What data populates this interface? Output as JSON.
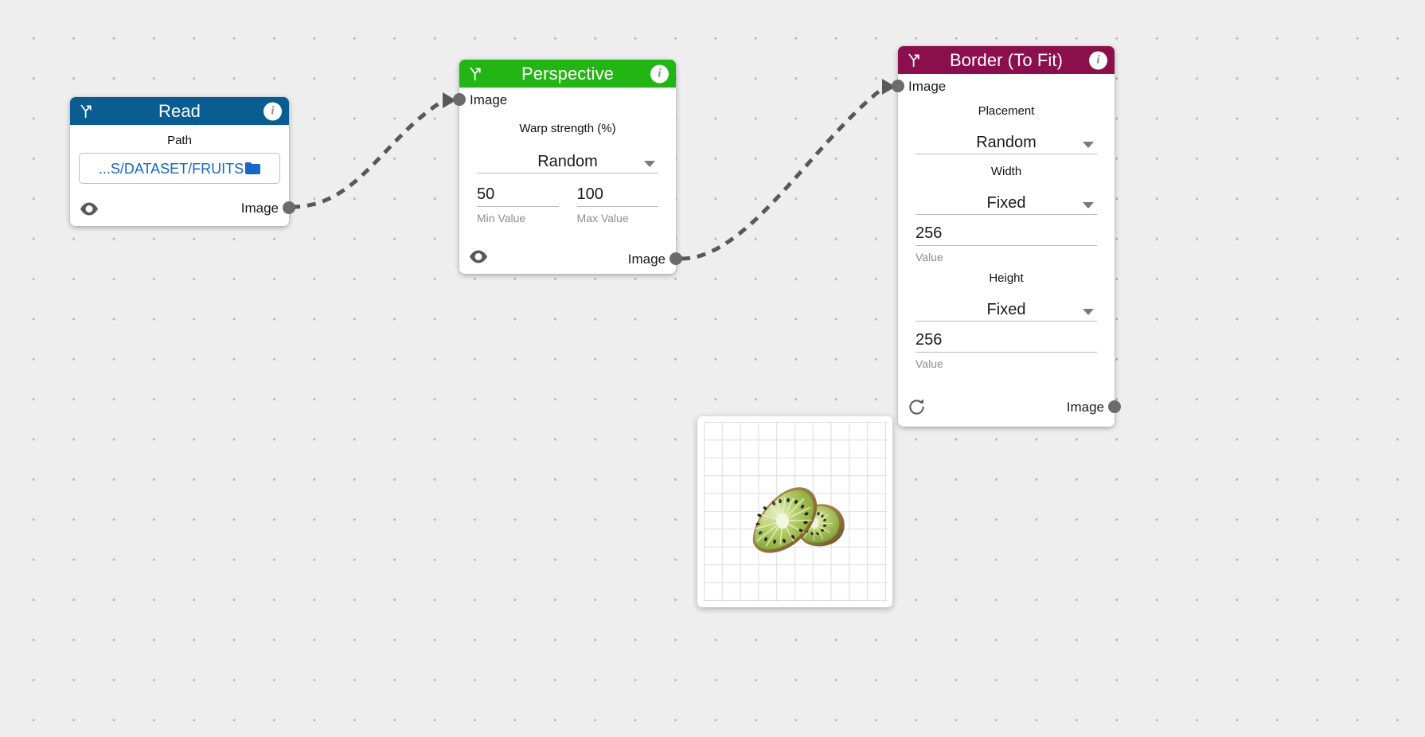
{
  "canvas": {
    "background_color": "#eeeeee",
    "dot_color": "#b4b4b4"
  },
  "nodes": [
    {
      "id": "read",
      "title": "Read",
      "header_color": "#0a5d92",
      "icon": "branch-icon",
      "info_label": "i",
      "fields": [
        {
          "label": "Path",
          "value": "...S/DATASET/FRUITS",
          "icon": "folder-icon"
        }
      ],
      "outputs": [
        {
          "label": "Image"
        }
      ],
      "footer_icon": "eye-icon"
    },
    {
      "id": "perspective",
      "title": "Perspective",
      "header_color": "#22b514",
      "icon": "branch-icon",
      "info_label": "i",
      "inputs": [
        {
          "label": "Image"
        }
      ],
      "fields": [
        {
          "label": "Warp strength (%)",
          "value": "Random",
          "type": "select"
        },
        {
          "value": "50",
          "helper": "Min Value",
          "type": "text"
        },
        {
          "value": "100",
          "helper": "Max Value",
          "type": "text"
        }
      ],
      "outputs": [
        {
          "label": "Image"
        }
      ],
      "footer_icon": "eye-icon"
    },
    {
      "id": "border",
      "title": "Border (To Fit)",
      "header_color": "#8b0f4d",
      "icon": "branch-icon",
      "info_label": "i",
      "inputs": [
        {
          "label": "Image"
        }
      ],
      "fields": [
        {
          "label": "Placement",
          "value": "Random",
          "type": "select"
        },
        {
          "label": "Width",
          "value": "Fixed",
          "type": "select"
        },
        {
          "value": "256",
          "helper": "Value",
          "type": "text"
        },
        {
          "label": "Height",
          "value": "Fixed",
          "type": "select"
        },
        {
          "value": "256",
          "helper": "Value",
          "type": "text"
        }
      ],
      "outputs": [
        {
          "label": "Image"
        }
      ],
      "footer_icon": "refresh-icon"
    }
  ],
  "read": {
    "title": "Read",
    "info": "i",
    "path_label": "Path",
    "path_value": "...S/DATASET/FRUITS",
    "output_label": "Image"
  },
  "perspective": {
    "title": "Perspective",
    "info": "i",
    "input_label": "Image",
    "warp_label": "Warp strength (%)",
    "mode_value": "Random",
    "min_value": "50",
    "min_helper": "Min Value",
    "max_value": "100",
    "max_helper": "Max Value",
    "output_label": "Image"
  },
  "border": {
    "title": "Border (To Fit)",
    "info": "i",
    "input_label": "Image",
    "placement_label": "Placement",
    "placement_value": "Random",
    "width_label": "Width",
    "width_mode": "Fixed",
    "width_value": "256",
    "width_helper": "Value",
    "height_label": "Height",
    "height_mode": "Fixed",
    "height_value": "256",
    "height_helper": "Value",
    "output_label": "Image"
  },
  "preview": {
    "content": "kiwi-slices-image"
  }
}
